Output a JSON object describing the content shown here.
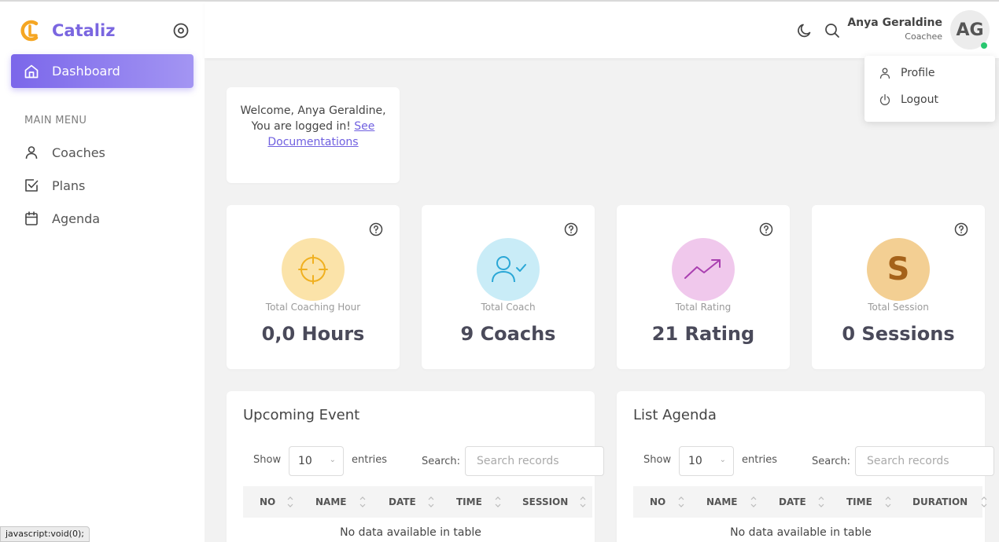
{
  "brand": {
    "name": "Cataliz"
  },
  "sidebar": {
    "active_item": "Dashboard",
    "menu_title": "MAIN MENU",
    "items": [
      {
        "label": "Coaches",
        "icon": "user-icon"
      },
      {
        "label": "Plans",
        "icon": "checkbox-icon"
      },
      {
        "label": "Agenda",
        "icon": "calendar-icon"
      }
    ]
  },
  "status_bar": {
    "text": "javascript:void(0);"
  },
  "header": {
    "user_name": "Anya Geraldine",
    "user_role": "Coachee",
    "avatar_initials": "AG"
  },
  "dropdown": {
    "items": [
      {
        "label": "Profile",
        "icon": "user-icon"
      },
      {
        "label": "Logout",
        "icon": "power-icon"
      }
    ]
  },
  "welcome": {
    "text": "Welcome, Anya Geraldine, You are logged in!",
    "link": "See Documentations"
  },
  "stats": [
    {
      "caption": "Total Coaching Hour",
      "value": "0,0 Hours",
      "icon": "target-icon",
      "color": "#fbe3a9"
    },
    {
      "caption": "Total Coach",
      "value": "9 Coachs",
      "icon": "user-check-icon",
      "color": "#c9ecf7"
    },
    {
      "caption": "Total Rating",
      "value": "21 Rating",
      "icon": "trending-up-icon",
      "color": "#f0c8ec"
    },
    {
      "caption": "Total Session",
      "value": "0 Sessions",
      "icon": "s-letter-icon",
      "color": "#f3cf93"
    }
  ],
  "upcoming": {
    "title": "Upcoming Event",
    "show": "Show",
    "entries_value": "10",
    "entries": "entries",
    "search_label": "Search:",
    "search_placeholder": "Search records",
    "columns": [
      "NO",
      "NAME",
      "DATE",
      "TIME",
      "SESSION"
    ],
    "empty": "No data available in table"
  },
  "agenda": {
    "title": "List Agenda",
    "show": "Show",
    "entries_value": "10",
    "entries": "entries",
    "search_label": "Search:",
    "search_placeholder": "Search records",
    "columns": [
      "NO",
      "NAME",
      "DATE",
      "TIME",
      "DURATION"
    ],
    "empty": "No data available in table"
  },
  "colors": {
    "accent": "#7b67ea",
    "logo_orange": "#f5a623",
    "online": "#28c76f"
  }
}
